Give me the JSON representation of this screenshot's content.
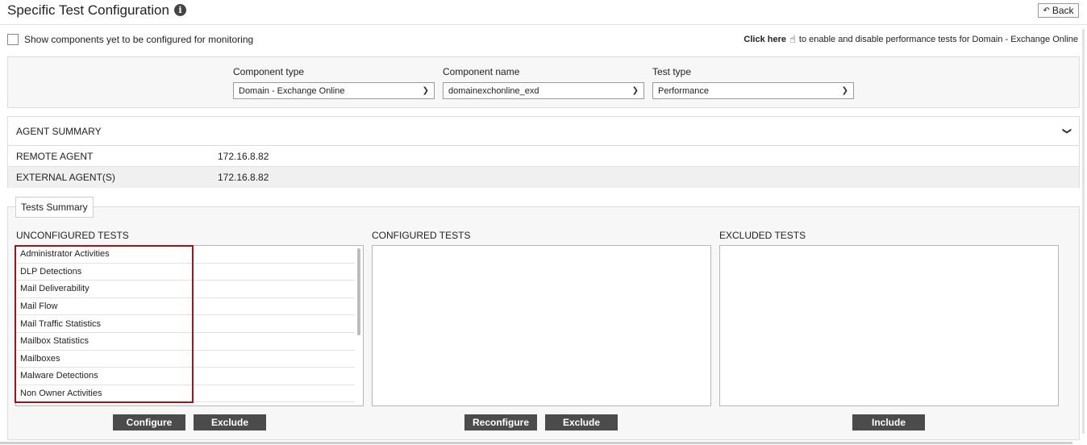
{
  "header": {
    "title": "Specific Test Configuration",
    "info_icon": "info-icon",
    "back_label": "Back"
  },
  "show_components": {
    "label": "Show components yet to be configured for monitoring",
    "checked": false
  },
  "click_here": {
    "link": "Click here",
    "text": "to enable and disable performance tests for Domain - Exchange Online"
  },
  "filters": {
    "component_type": {
      "label": "Component type",
      "value": "Domain - Exchange Online"
    },
    "component_name": {
      "label": "Component name",
      "value": "domainexchonline_exd"
    },
    "test_type": {
      "label": "Test type",
      "value": "Performance"
    }
  },
  "agent_summary": {
    "title": "AGENT SUMMARY",
    "rows": [
      {
        "key": "REMOTE AGENT",
        "value": "172.16.8.82"
      },
      {
        "key": "EXTERNAL AGENT(S)",
        "value": "172.16.8.82"
      }
    ]
  },
  "tests_summary": {
    "tab_label": "Tests Summary",
    "unconfigured": {
      "label": "UNCONFIGURED TESTS",
      "items": [
        "Administrator Activities",
        "DLP Detections",
        "Mail Deliverability",
        "Mail Flow",
        "Mail Traffic Statistics",
        "Mailbox Statistics",
        "Mailboxes",
        "Malware Detections",
        "Non Owner Activities"
      ]
    },
    "configured": {
      "label": "CONFIGURED TESTS",
      "items": []
    },
    "excluded": {
      "label": "EXCLUDED TESTS",
      "items": []
    }
  },
  "buttons": {
    "configure": "Configure",
    "exclude_unconfigured": "Exclude",
    "reconfigure": "Reconfigure",
    "exclude_configured": "Exclude",
    "include": "Include"
  },
  "colors": {
    "highlight_border": "#a01418",
    "button_bg": "#4b4b4b",
    "panel_bg": "#f7f7f7"
  }
}
